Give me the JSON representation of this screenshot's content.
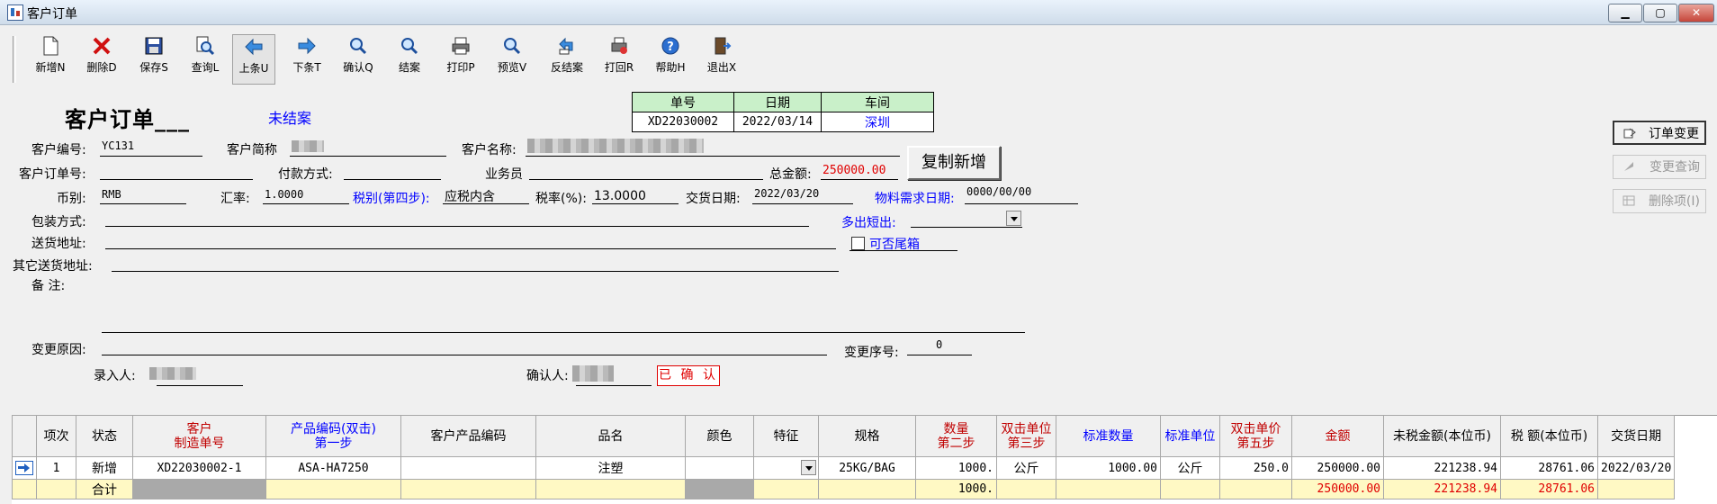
{
  "window": {
    "title": "客户订单",
    "min": "▁",
    "max": "▢",
    "close": "✕"
  },
  "toolbar": [
    {
      "label": "新增N",
      "icon": "new-document-icon"
    },
    {
      "label": "删除D",
      "icon": "delete-x-icon"
    },
    {
      "label": "保存S",
      "icon": "save-disk-icon"
    },
    {
      "label": "查询L",
      "icon": "query-magnifier-icon"
    },
    {
      "label": "上条U",
      "icon": "arrow-left-icon"
    },
    {
      "label": "下条T",
      "icon": "arrow-right-icon"
    },
    {
      "label": "确认Q",
      "icon": "confirm-magnifier-icon"
    },
    {
      "label": "结案",
      "icon": "close-case-magnifier-icon"
    },
    {
      "label": "打印P",
      "icon": "printer-icon"
    },
    {
      "label": "预览V",
      "icon": "preview-magnifier-icon"
    },
    {
      "label": "反结案",
      "icon": "undo-arrow-icon"
    },
    {
      "label": "打回R",
      "icon": "return-printer-icon"
    },
    {
      "label": "帮助H",
      "icon": "help-question-icon"
    },
    {
      "label": "退出X",
      "icon": "exit-door-icon"
    }
  ],
  "header": {
    "form_title": "客户订单___",
    "status": "未结案",
    "info": {
      "col_no": "单号",
      "col_date": "日期",
      "col_workshop": "车间",
      "no": "XD22030002",
      "date": "2022/03/14",
      "workshop": "深圳"
    }
  },
  "form": {
    "customer_code_label": "客户编号:",
    "customer_code": "YC131",
    "customer_short_label": "客户简称",
    "customer_name_label": "客户名称:",
    "customer_order_label": "客户订单号:",
    "payment_label": "付款方式:",
    "sales_label": "业务员",
    "total_label": "总金额:",
    "total": "250000.00",
    "currency_label": "币别:",
    "currency": "RMB",
    "rate_label": "汇率:",
    "rate": "1.0000",
    "tax_type_label": "税别(第四步):",
    "tax_type": "应税内含",
    "tax_rate_label": "税率(%):",
    "tax_rate": "13.0000",
    "delivery_date_label": "交货日期:",
    "delivery_date": "2022/03/20",
    "material_date_label": "物料需求日期:",
    "material_date": "0000/00/00",
    "packing_label": "包装方式:",
    "over_short_label": "多出短出:",
    "ship_addr_label": "送货地址:",
    "tail_box_label": "可否尾箱",
    "other_addr_label": "其它送货地址:",
    "remark_label": "备    注:",
    "change_reason_label": "变更原因:",
    "change_seq_label": "变更序号:",
    "change_seq": "0",
    "entered_by_label": "录入人:",
    "confirmed_by_label": "确认人:",
    "confirmed_badge": "已 确 认"
  },
  "buttons": {
    "copy_new": "复制新增",
    "order_change": "订单变更",
    "change_query": "变更查询",
    "delete_item": "删除项(I)"
  },
  "grid": {
    "columns": [
      {
        "line1": "项次",
        "line2": "",
        "color": "#000000"
      },
      {
        "line1": "状态",
        "line2": "",
        "color": "#000000"
      },
      {
        "line1": "客户",
        "line2": "制造单号",
        "color": "#c00000"
      },
      {
        "line1": "产品编码(双击)",
        "line2": "第一步",
        "color": "#0000ff"
      },
      {
        "line1": "客户产品编码",
        "line2": "",
        "color": "#000000"
      },
      {
        "line1": "品名",
        "line2": "",
        "color": "#000000"
      },
      {
        "line1": "颜色",
        "line2": "",
        "color": "#000000"
      },
      {
        "line1": "特征",
        "line2": "",
        "color": "#000000"
      },
      {
        "line1": "规格",
        "line2": "",
        "color": "#000000"
      },
      {
        "line1": "数量",
        "line2": "第二步",
        "color": "#c00000"
      },
      {
        "line1": "双击单位",
        "line2": "第三步",
        "color": "#c00000"
      },
      {
        "line1": "标准数量",
        "line2": "",
        "color": "#0000ff"
      },
      {
        "line1": "标准单位",
        "line2": "",
        "color": "#0000ff"
      },
      {
        "line1": "双击单价",
        "line2": "第五步",
        "color": "#c00000"
      },
      {
        "line1": "金额",
        "line2": "",
        "color": "#c00000"
      },
      {
        "line1": "未税金额(本位币)",
        "line2": "",
        "color": "#000000"
      },
      {
        "line1": "税 额(本位币)",
        "line2": "",
        "color": "#000000"
      },
      {
        "line1": "交货日期",
        "line2": "",
        "color": "#000000"
      }
    ],
    "row": {
      "item": "1",
      "status": "新增",
      "mfg_no": "XD22030002-1",
      "product_code": "ASA-HA7250",
      "cust_product_code": "",
      "name": "注塑",
      "color": "",
      "feature": "",
      "spec": "25KG/BAG",
      "qty": "1000.",
      "unit": "公斤",
      "std_qty": "1000.00",
      "std_unit": "公斤",
      "price": "250.0",
      "amount": "250000.00",
      "untaxed": "221238.94",
      "tax": "28761.06",
      "delivery": "2022/03/20"
    },
    "sum": {
      "label": "合计",
      "qty": "1000.",
      "amount": "250000.00",
      "untaxed": "221238.94",
      "tax": "28761.06"
    }
  }
}
